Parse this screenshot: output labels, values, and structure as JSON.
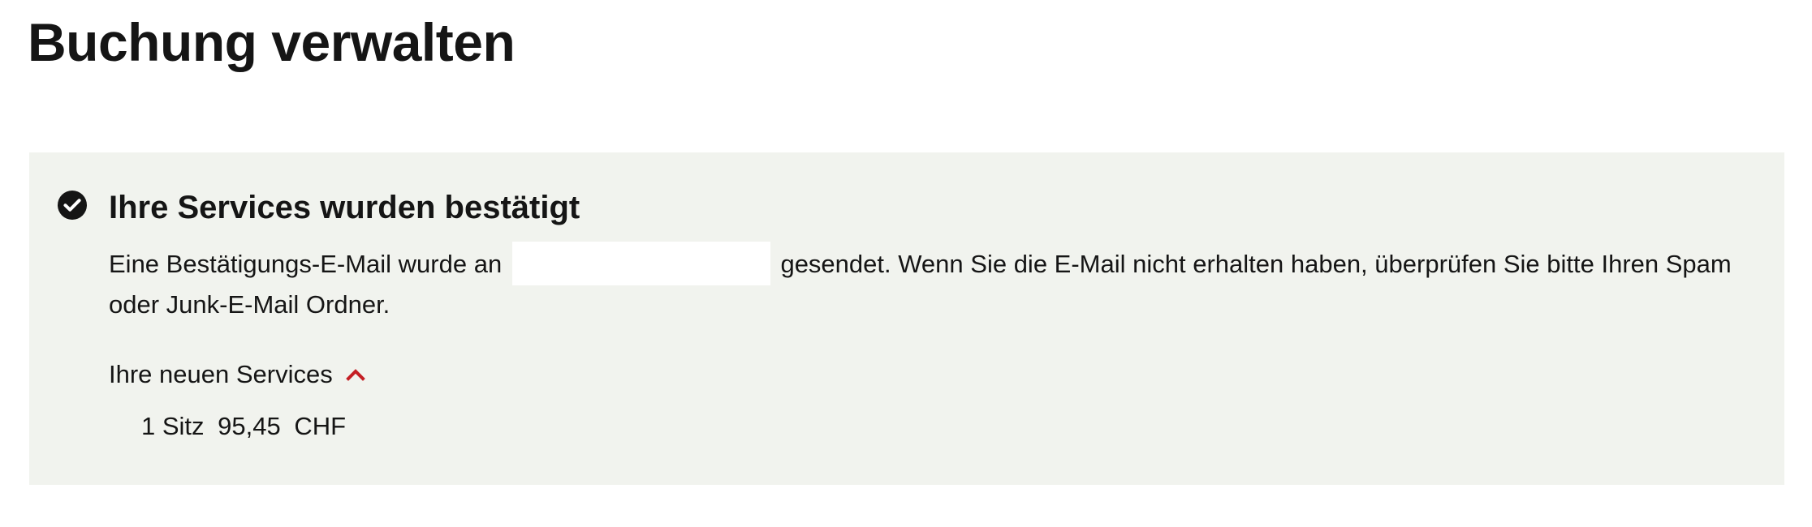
{
  "page": {
    "title": "Buchung verwalten"
  },
  "confirmation": {
    "icon": "check-circle-icon",
    "title": "Ihre Services wurden bestätigt",
    "message_before_email": "Eine Bestätigungs-E-Mail wurde an",
    "email": "",
    "message_after_email": "gesendet. Wenn Sie die E-Mail nicht erhalten haben, überprüfen Sie bitte Ihren Spam oder Junk-E-Mail Ordner."
  },
  "services": {
    "toggle_label": "Ihre neuen Services",
    "toggle_icon": "chevron-up-icon",
    "expanded": true,
    "items": [
      {
        "quantity_label": "1 Sitz",
        "price": "95,45",
        "currency": "CHF"
      }
    ]
  },
  "colors": {
    "panel_background": "#f1f3ee",
    "accent_red": "#c41e24",
    "text": "#151515",
    "redaction": "#ffffff"
  }
}
